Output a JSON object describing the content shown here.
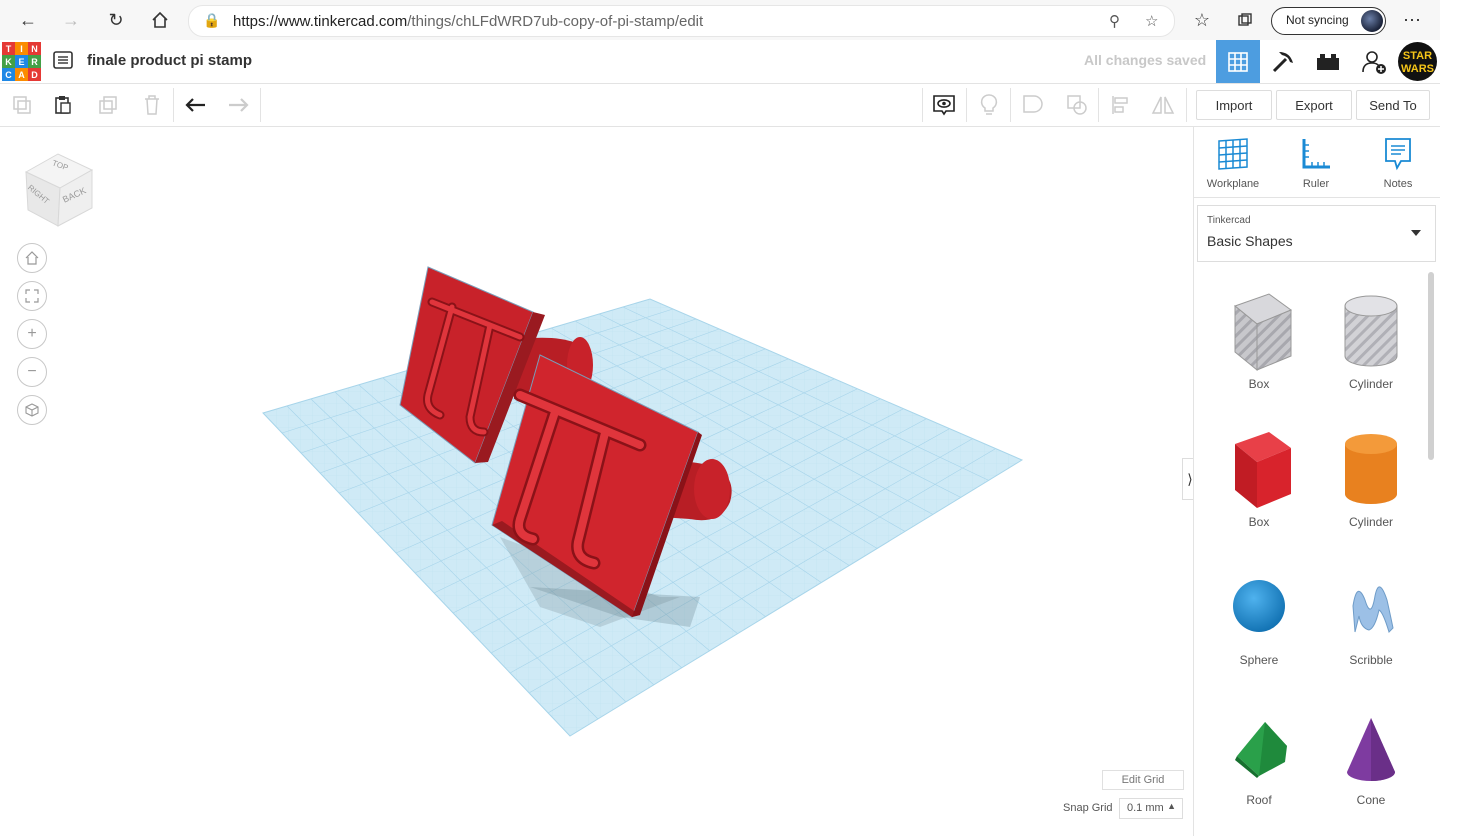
{
  "browser": {
    "url_main": "https://www.tinkercad.com",
    "url_path": "/things/chLFdWRD7ub-copy-of-pi-stamp/edit",
    "sync_label": "Not syncing"
  },
  "app": {
    "logo_letters": [
      "TIN",
      "KER",
      "CAD"
    ],
    "project_title": "finale product pi stamp",
    "save_status": "All changes saved"
  },
  "toolbar": {
    "import_label": "Import",
    "export_label": "Export",
    "send_to_label": "Send To"
  },
  "view_cube": {
    "top": "TOP",
    "right": "RIGHT",
    "back": "BACK"
  },
  "canvas": {
    "edit_grid_label": "Edit Grid",
    "snap_grid_label": "Snap Grid",
    "snap_grid_value": "0.1 mm"
  },
  "sidebar": {
    "tools": [
      {
        "label": "Workplane",
        "icon": "workplane-icon"
      },
      {
        "label": "Ruler",
        "icon": "ruler-icon"
      },
      {
        "label": "Notes",
        "icon": "notes-icon"
      }
    ],
    "library_source": "Tinkercad",
    "library_name": "Basic Shapes",
    "shapes": [
      {
        "label": "Box",
        "icon": "box-hole-icon",
        "color": "#b8b8c0"
      },
      {
        "label": "Cylinder",
        "icon": "cylinder-hole-icon",
        "color": "#c8c8cc"
      },
      {
        "label": "Box",
        "icon": "box-icon",
        "color": "#d8232c"
      },
      {
        "label": "Cylinder",
        "icon": "cylinder-icon",
        "color": "#e8811f"
      },
      {
        "label": "Sphere",
        "icon": "sphere-icon",
        "color": "#1a8ad4"
      },
      {
        "label": "Scribble",
        "icon": "scribble-icon",
        "color": "#8fb8e0"
      },
      {
        "label": "Roof",
        "icon": "roof-icon",
        "color": "#2aa04a"
      },
      {
        "label": "Cone",
        "icon": "cone-icon",
        "color": "#7e3ba0"
      }
    ]
  },
  "colors": {
    "accent_blue": "#4d9de0",
    "stamp_red": "#d8232c",
    "grid_blue": "#bfe3f2"
  }
}
